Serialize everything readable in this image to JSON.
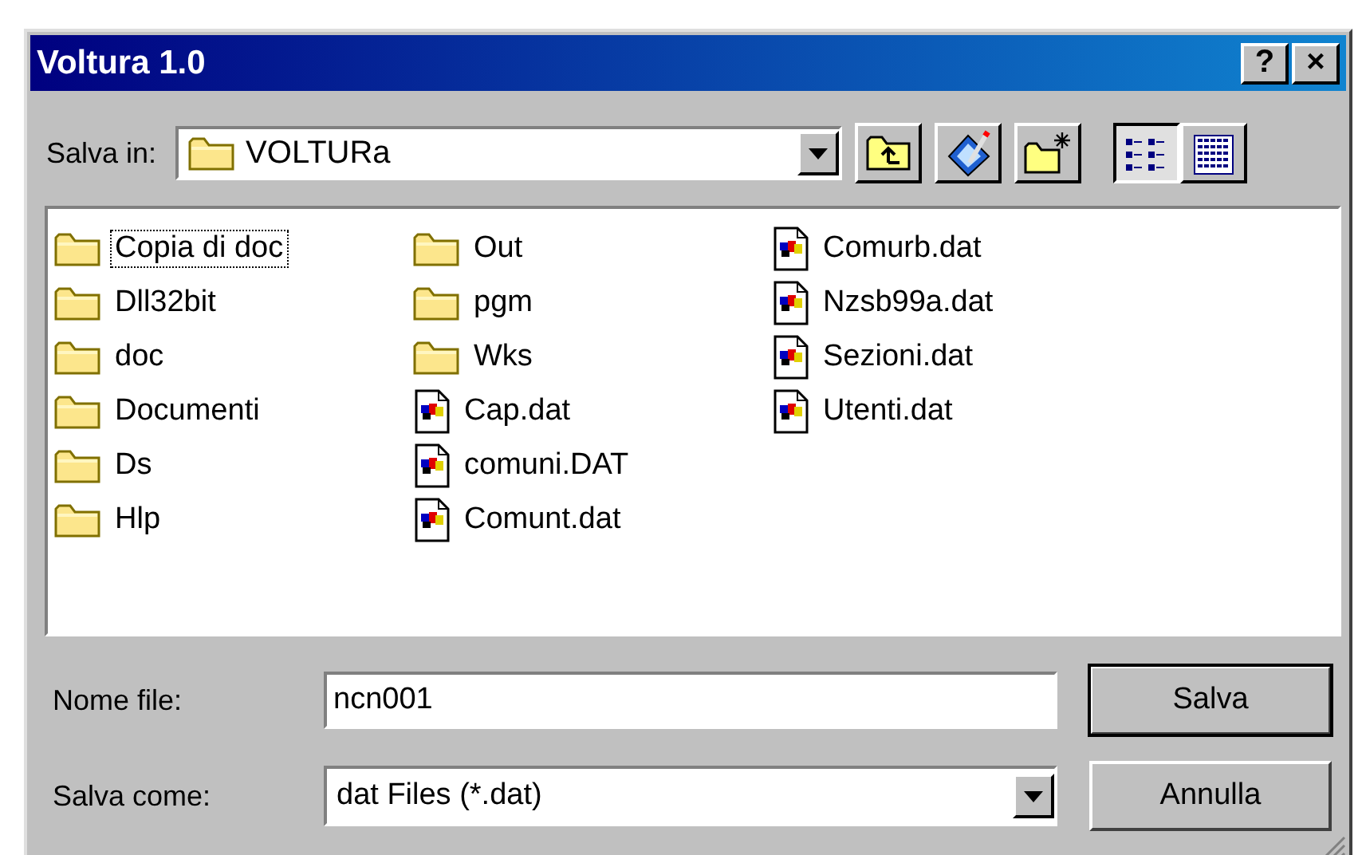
{
  "window": {
    "title": "Voltura 1.0",
    "help_button": "?",
    "close_button": "×"
  },
  "location": {
    "label": "Salva in:",
    "value": "VOLTURa"
  },
  "toolbar": [
    {
      "kind": "up-folder"
    },
    {
      "kind": "desktop"
    },
    {
      "kind": "new-folder"
    }
  ],
  "view_buttons": [
    {
      "kind": "list",
      "selected": true
    },
    {
      "kind": "details",
      "selected": false
    }
  ],
  "files": [
    {
      "name": "Copia di doc",
      "kind": "folder",
      "focused": true
    },
    {
      "name": "Dll32bit",
      "kind": "folder",
      "focused": false
    },
    {
      "name": "doc",
      "kind": "folder",
      "focused": false
    },
    {
      "name": "Documenti",
      "kind": "folder",
      "focused": false
    },
    {
      "name": "Ds",
      "kind": "folder",
      "focused": false
    },
    {
      "name": "Hlp",
      "kind": "folder",
      "focused": false
    },
    {
      "name": "Out",
      "kind": "folder",
      "focused": false
    },
    {
      "name": "pgm",
      "kind": "folder",
      "focused": false
    },
    {
      "name": "Wks",
      "kind": "folder",
      "focused": false
    },
    {
      "name": "Cap.dat",
      "kind": "file",
      "focused": false
    },
    {
      "name": "comuni.DAT",
      "kind": "file",
      "focused": false
    },
    {
      "name": "Comunt.dat",
      "kind": "file",
      "focused": false
    },
    {
      "name": "Comurb.dat",
      "kind": "file",
      "focused": false
    },
    {
      "name": "Nzsb99a.dat",
      "kind": "file",
      "focused": false
    },
    {
      "name": "Sezioni.dat",
      "kind": "file",
      "focused": false
    },
    {
      "name": "Utenti.dat",
      "kind": "file",
      "focused": false
    }
  ],
  "filename": {
    "label": "Nome file:",
    "value": "ncn001"
  },
  "filetype": {
    "label": "Salva come:",
    "value": "dat Files (*.dat)"
  },
  "buttons": [
    {
      "label": "Salva",
      "default": true
    },
    {
      "label": "Annulla",
      "default": false
    }
  ]
}
